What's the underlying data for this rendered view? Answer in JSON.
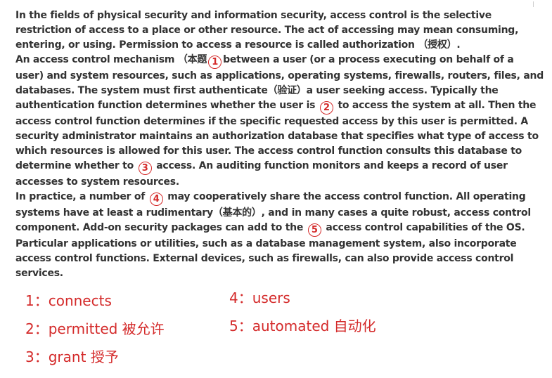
{
  "passage": {
    "p1": "In the fields of physical security and information security, access control is the selective restriction of access to a place or other resource. The act of accessing may mean consuming, entering, or using. Permission to access a resource is called authorization （授权）.",
    "p2_a": "An access control mechanism （本题",
    "p2_b": "between a user (or a process executing on behalf of a user) and system resources, such as applications, operating systems, firewalls, routers, files, and databases. The system must first authenticate（验证）a user seeking access. Typically the authentication function determines whether the user is",
    "p2_c": "to access the system at all. Then the access control function determines if the specific requested access by this user is permitted. A security administrator maintains an authorization database that specifies what type of access to which resources is allowed for this user. The access control function consults this database to determine whether to",
    "p2_d": "access. An auditing function monitors and keeps a record of user accesses to system resources.",
    "p3_a": "In practice, a number of",
    "p3_b": "may cooperatively share the access control function. All operating systems have at least a rudimentary（基本的）, and in many cases a quite robust, access control component. Add-on security packages can add to the",
    "p3_c": "access control capabilities of the OS. Particular applications or utilities, such as a database management system, also incorporate access control functions. External devices, such as firewalls, can also provide access control services."
  },
  "blanks": {
    "b1": "1",
    "b2": "2",
    "b3": "3",
    "b4": "4",
    "b5": "5"
  },
  "answers": {
    "a1": "1：connects",
    "a2": "2：permitted 被允许",
    "a3": "3：grant 授予",
    "a4": "4：users",
    "a5": "5：automated 自动化"
  }
}
